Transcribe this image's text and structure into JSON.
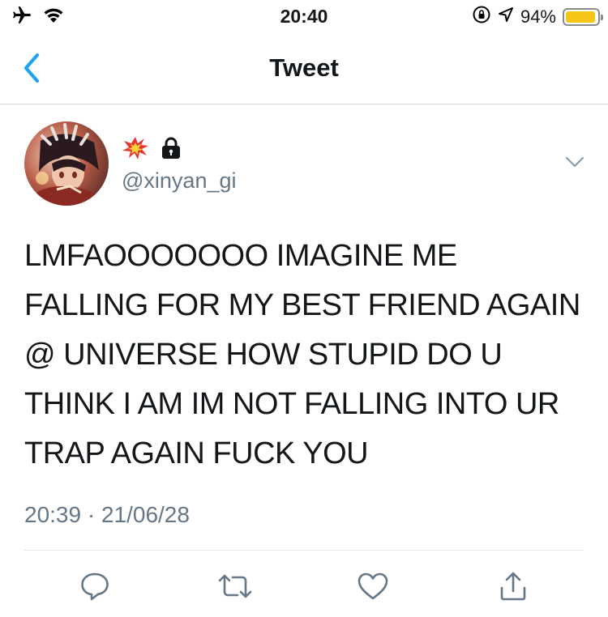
{
  "status_bar": {
    "time": "20:40",
    "battery_percent": "94%",
    "battery_level": 0.94,
    "icons": [
      "airplane-icon",
      "wifi-icon",
      "orientation-lock-icon",
      "location-icon",
      "battery-icon"
    ]
  },
  "nav": {
    "title": "Tweet",
    "back_icon": "chevron-left-icon"
  },
  "tweet": {
    "display_name_icons": [
      "collision-emoji-icon",
      "lock-icon"
    ],
    "handle": "@xinyan_gi",
    "text": "LMFAOOOOOOO IMAGINE ME FALLING FOR MY BEST FRIEND AGAIN @ UNIVERSE HOW STUPID DO U THINK I AM IM NOT FALLING INTO UR TRAP AGAIN FUCK YOU",
    "timestamp": "20:39 · 21/06/28"
  },
  "actions": [
    "reply-icon",
    "retweet-icon",
    "like-icon",
    "share-icon"
  ],
  "colors": {
    "accent": "#1da1f2",
    "secondary_text": "#657786",
    "battery": "#f5c518"
  }
}
